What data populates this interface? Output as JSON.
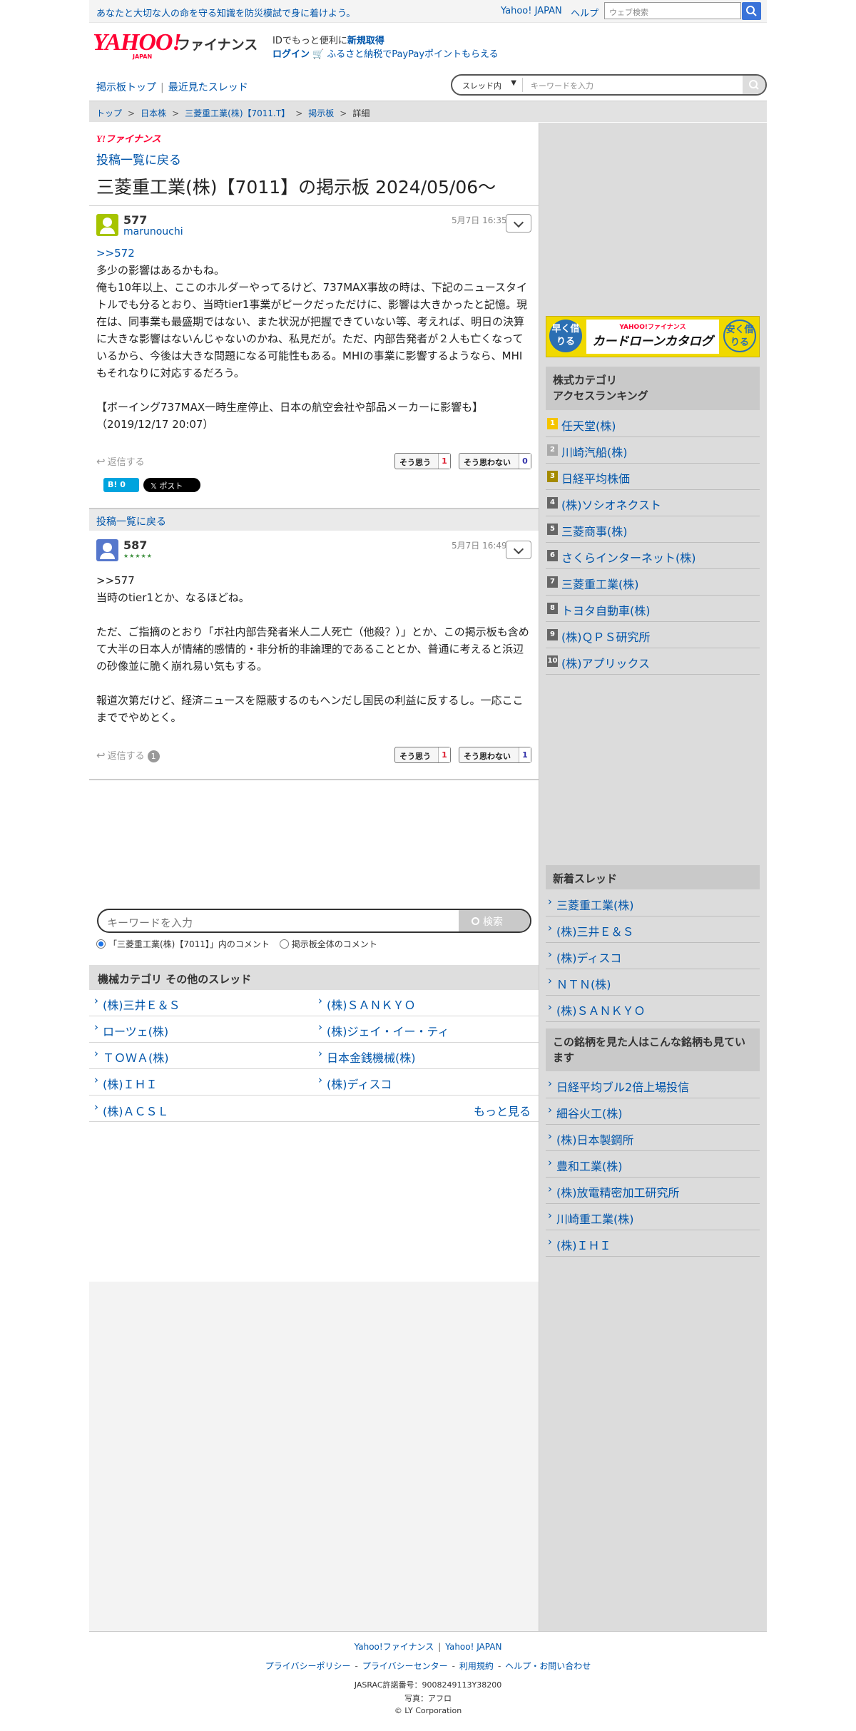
{
  "topbar": {
    "promo": "あなたと大切な人の命を守る知識を防災模試で身に着けよう。",
    "yahoo_japan": "Yahoo! JAPAN",
    "help": "ヘルプ",
    "web_search_placeholder": "ウェブ検索"
  },
  "header": {
    "logo_main": "YAHOO!",
    "logo_sub": "JAPAN",
    "site_name": "ファイナンス",
    "id_prefix": "IDでもっと便利に",
    "id_register": "新規取得",
    "login": "ログイン",
    "furusato": "ふるさと納税でPayPayポイントもらえる"
  },
  "nav": {
    "board_top": "掲示板トップ",
    "recent": "最近見たスレッド",
    "scope": "スレッド内",
    "search_placeholder": "キーワードを入力"
  },
  "breadcrumb": [
    "トップ",
    "日本株",
    "三菱重工業(株)【7011.T】",
    "掲示板",
    "詳細"
  ],
  "thread": {
    "brand": "Y!ファイナンス",
    "back_label": "投稿一覧に戻る",
    "title": "三菱重工業(株)【7011】の掲示板 2024/05/06〜"
  },
  "posts": [
    {
      "number": "577",
      "user": "marunouchi",
      "date": "5月7日 16:35",
      "ref": ">>572",
      "text": "多少の影響はあるかもね。\n俺も10年以上、ここのホルダーやってるけど、737MAX事故の時は、下記のニュースタイトルでも分るとおり、当時tier1事業がピークだっただけに、影響は大きかったと記憶。現在は、同事業も最盛期ではない、また状況が把握できていない等、考えれば、明日の決算に大きな影響はないんじゃないのかね、私見だが。ただ、内部告発者が２人も亡くなっているから、今後は大きな問題になる可能性もある。MHIの事業に影響するようなら、MHIもそれなりに対応するだろう。\n\n【ボーイング737MAX一時生産停止、日本の航空会社や部品メーカーに影響も】\n（2019/12/17 20:07）",
      "reply": "返信する",
      "agree_label": "そう思う",
      "agree": "1",
      "disagree_label": "そう思わない",
      "disagree": "0",
      "hatena": "0",
      "xpost": "ポスト"
    },
    {
      "number": "587",
      "stars": "★★★★★",
      "date": "5月7日 16:49",
      "text": ">>577\n当時のtier1とか、なるほどね。\n\nただ、ご指摘のとおり「ボ社内部告発者米人二人死亡（他殺？）」とか、この掲示板も含めて大半の日本人が情緒的感情的・非分析的非論理的であることとか、普通に考えると浜辺の砂像並に脆く崩れ易い気もする。\n\n報道次第だけど、経済ニュースを隠蔽するのもヘンだし国民の利益に反するし。一応ここまででやめとく。",
      "reply": "返信する",
      "reply_count": "1",
      "agree_label": "そう思う",
      "agree": "1",
      "disagree_label": "そう思わない",
      "disagree": "1"
    }
  ],
  "bottom_search": {
    "placeholder": "キーワードを入力",
    "button": "検索",
    "scope_thread": "「三菱重工業(株)【7011】」内のコメント",
    "scope_all": "掲示板全体のコメント"
  },
  "others": {
    "heading": "機械カテゴリ その他のスレッド",
    "items": [
      "(株)三井Ｅ＆Ｓ",
      "(株)ＳＡＮＫＹＯ",
      "ローツェ(株)",
      "(株)ジェイ・イー・ティ",
      "ＴＯＷＡ(株)",
      "日本金銭機械(株)",
      "(株)ＩＨＩ",
      "(株)ディスコ",
      "(株)ＡＣＳＬ"
    ],
    "more": "もっと見る"
  },
  "sidebar": {
    "banner": {
      "left": "早く借りる",
      "brand": "YAHOO!ファイナンス",
      "title": "カードローンカタログ",
      "right": "安く借りる"
    },
    "ranking_heading": "株式カテゴリ\nアクセスランキング",
    "ranking": [
      {
        "num": "1",
        "name": "任天堂(株)"
      },
      {
        "num": "2",
        "name": "川崎汽船(株)"
      },
      {
        "num": "3",
        "name": "日経平均株価"
      },
      {
        "num": "4",
        "name": "(株)ソシオネクスト"
      },
      {
        "num": "5",
        "name": "三菱商事(株)"
      },
      {
        "num": "6",
        "name": "さくらインターネット(株)"
      },
      {
        "num": "7",
        "name": "三菱重工業(株)"
      },
      {
        "num": "8",
        "name": "トヨタ自動車(株)"
      },
      {
        "num": "9",
        "name": "(株)ＱＰＳ研究所"
      },
      {
        "num": "10",
        "name": "(株)アプリックス"
      }
    ],
    "new_heading": "新着スレッド",
    "new_threads": [
      "三菱重工業(株)",
      "(株)三井Ｅ＆Ｓ",
      "(株)ディスコ",
      "ＮＴＮ(株)",
      "(株)ＳＡＮＫＹＯ"
    ],
    "viewers_heading": "この銘柄を見た人はこんな銘柄も見ています",
    "viewers": [
      "日経平均ブル2倍上場投信",
      "細谷火工(株)",
      "(株)日本製鋼所",
      "豊和工業(株)",
      "(株)放電精密加工研究所",
      "川崎重工業(株)",
      "(株)ＩＨＩ"
    ]
  },
  "footer": {
    "links1": [
      "Yahoo!ファイナンス",
      "Yahoo! JAPAN"
    ],
    "links2": [
      "プライバシーポリシー",
      "プライバシーセンター",
      "利用規約",
      "ヘルプ・お問い合わせ"
    ],
    "jasrac": "JASRAC許諾番号：9008249113Y38200",
    "photo": "写真：アフロ",
    "copyright": "© LY Corporation"
  },
  "colors": {
    "accent": "#0055aa",
    "brand_red": "#ff0033",
    "avatar1": "#a6c400",
    "avatar2": "#5577cc"
  }
}
